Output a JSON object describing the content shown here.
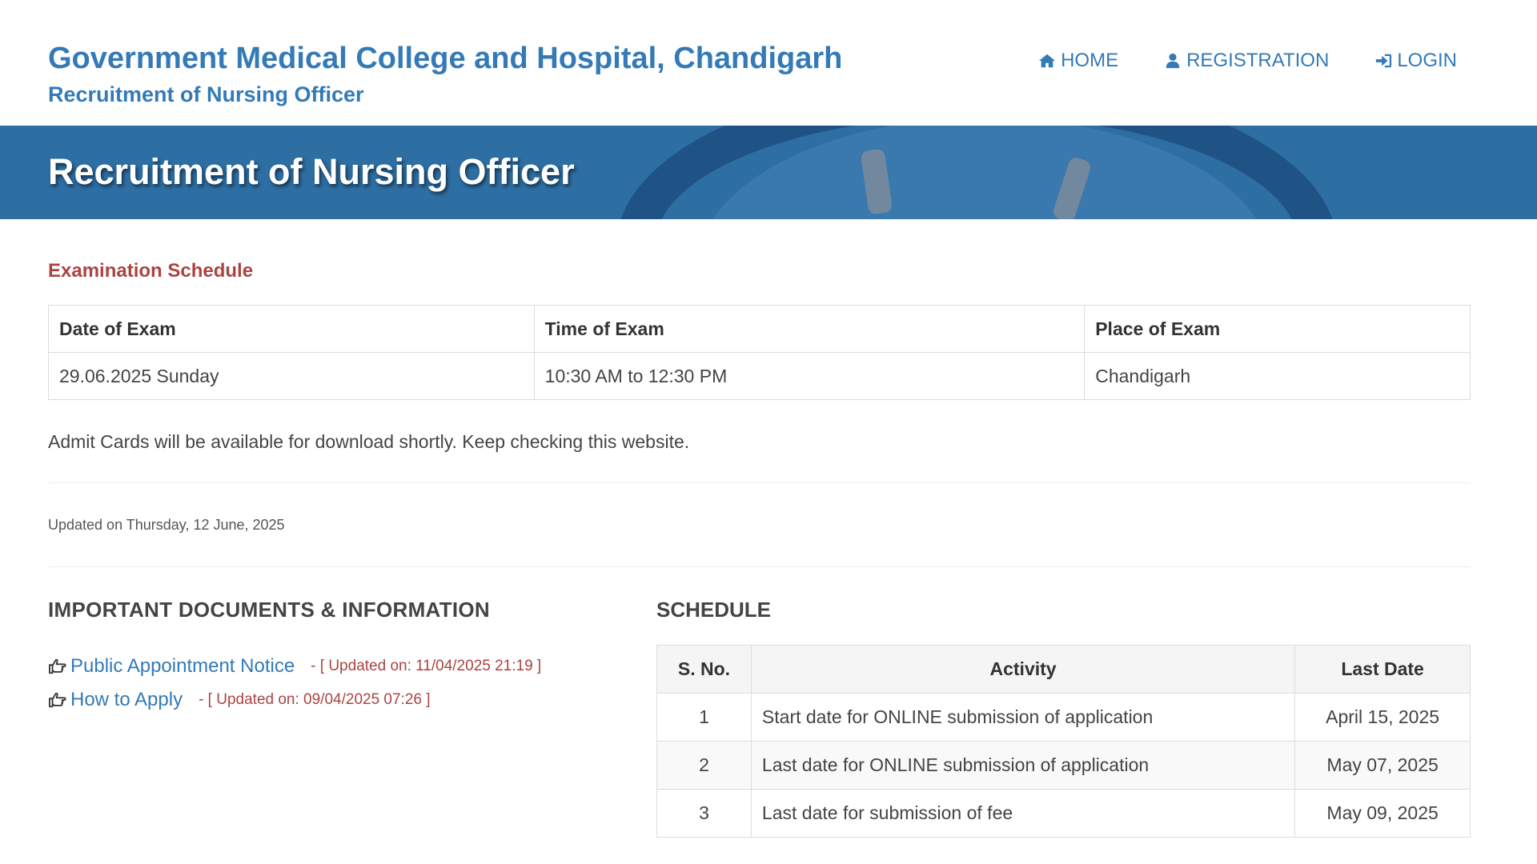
{
  "header": {
    "site_title": "Government Medical College and Hospital, Chandigarh",
    "site_subtitle": "Recruitment of Nursing Officer",
    "nav": [
      {
        "label": "HOME",
        "icon": "home-icon"
      },
      {
        "label": "REGISTRATION",
        "icon": "user-icon"
      },
      {
        "label": "LOGIN",
        "icon": "sign-in-icon"
      }
    ]
  },
  "banner": {
    "title": "Recruitment of Nursing Officer"
  },
  "exam_schedule": {
    "heading": "Examination Schedule",
    "columns": [
      "Date of Exam",
      "Time of Exam",
      "Place of Exam"
    ],
    "rows": [
      [
        "29.06.2025 Sunday",
        "10:30 AM to 12:30 PM",
        "Chandigarh"
      ]
    ],
    "note": "Admit Cards will be available for download shortly. Keep checking this website.",
    "updated_on": "Updated on Thursday, 12 June, 2025"
  },
  "documents": {
    "heading": "IMPORTANT DOCUMENTS & INFORMATION",
    "items": [
      {
        "label": "Public Appointment Notice",
        "meta": "- [ Updated on: 11/04/2025 21:19 ]",
        "icon": "hand-pointing-right-icon"
      },
      {
        "label": "How to Apply",
        "meta": "- [ Updated on: 09/04/2025 07:26 ]",
        "icon": "hand-pointing-right-icon"
      }
    ]
  },
  "schedule": {
    "heading": "SCHEDULE",
    "columns": [
      "S. No.",
      "Activity",
      "Last Date"
    ],
    "rows": [
      [
        "1",
        "Start date for ONLINE submission of application",
        "April 15, 2025"
      ],
      [
        "2",
        "Last date for ONLINE submission of application",
        "May 07, 2025"
      ],
      [
        "3",
        "Last date for submission of fee",
        "May 09, 2025"
      ]
    ]
  },
  "colors": {
    "brand_blue": "#337ab7",
    "banner_blue": "#2d6ea3",
    "heading_red": "#a94442"
  }
}
